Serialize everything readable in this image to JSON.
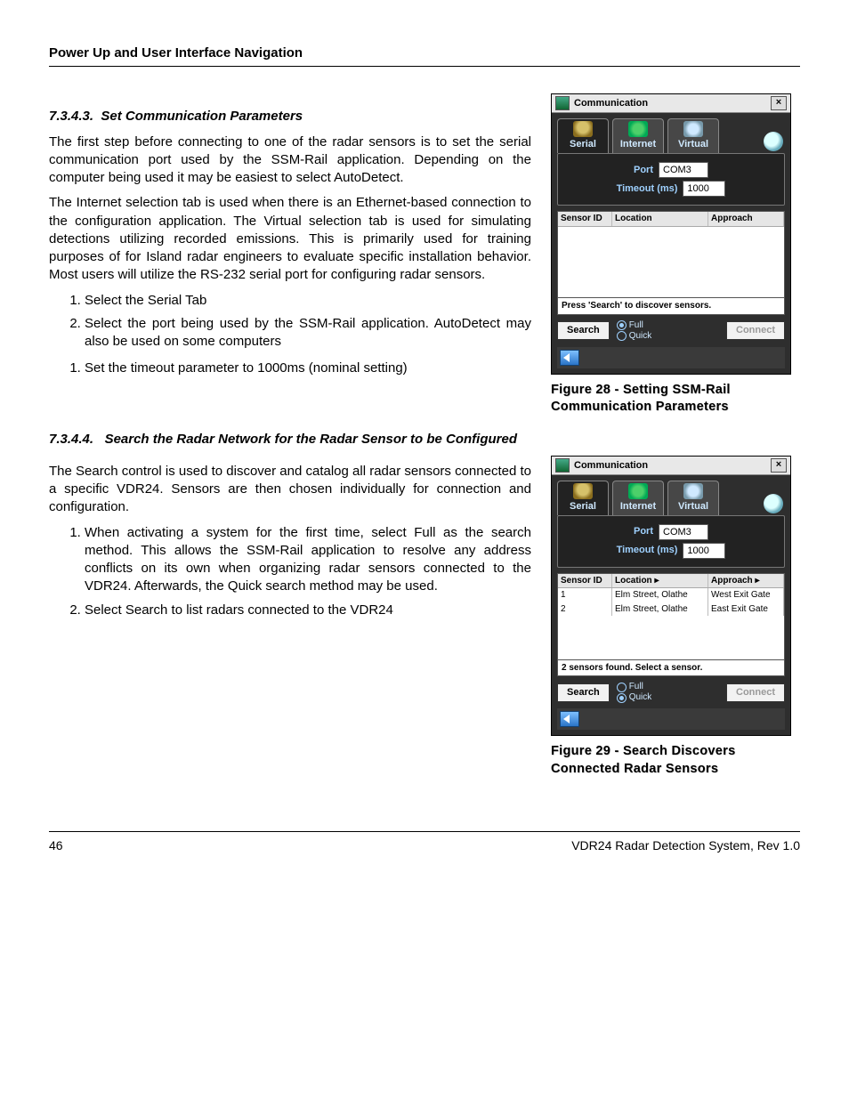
{
  "header": "Power Up and User Interface Navigation",
  "sec1": {
    "num": "7.3.4.3.",
    "title": "Set Communication Parameters",
    "p1": "The first step before connecting to one of the radar sensors is to set the serial communication port used by the SSM-Rail application. Depending on the computer being used it may be easiest to select AutoDetect.",
    "p2": "The Internet selection tab is used when there is an Ethernet-based connection to the configuration application. The Virtual selection tab is used for simulating detections utilizing recorded emissions. This is primarily used for training purposes of for Island radar engineers to evaluate specific installation behavior. Most users will utilize the RS-232 serial port for configuring radar sensors.",
    "li1": "Select the Serial Tab",
    "li2": "Select the port being used by the SSM-Rail application. AutoDetect may also be used on some computers",
    "li3": "Set the timeout parameter to 1000ms (nominal setting)"
  },
  "sec2": {
    "num": "7.3.4.4.",
    "title": "Search the Radar Network for the Radar Sensor to be Configured",
    "p1": "The Search control is used to discover and catalog all radar sensors connected to a specific VDR24. Sensors are then chosen individually for connection and configuration.",
    "li1": "When activating a system for the first time, select Full as the search method. This allows the SSM-Rail application to resolve any address conflicts on its own when organizing radar sensors connected to the VDR24. Afterwards, the Quick search method may be used.",
    "li2": "Select Search to list radars connected to the VDR24"
  },
  "win": {
    "title": "Communication",
    "tabs": {
      "serial": "Serial",
      "internet": "Internet",
      "virtual": "Virtual"
    },
    "port_label": "Port",
    "port_value": "COM3",
    "timeout_label": "Timeout (ms)",
    "timeout_value": "1000",
    "cols": {
      "id": "Sensor ID",
      "loc": "Location",
      "app": "Approach"
    },
    "status_empty": "Press 'Search' to discover sensors.",
    "status_found": "2 sensors found. Select a sensor.",
    "search": "Search",
    "connect": "Connect",
    "full": "Full",
    "quick": "Quick",
    "rows": [
      {
        "id": "1",
        "loc": "Elm Street, Olathe",
        "app": "West Exit Gate"
      },
      {
        "id": "2",
        "loc": "Elm Street, Olathe",
        "app": "East Exit Gate"
      }
    ]
  },
  "fig1": "Figure 28 - Setting SSM-Rail Communication Parameters",
  "fig2": "Figure 29 - Search Discovers Connected Radar Sensors",
  "footer": {
    "page": "46",
    "doc": "VDR24 Radar Detection System, Rev 1.0"
  }
}
